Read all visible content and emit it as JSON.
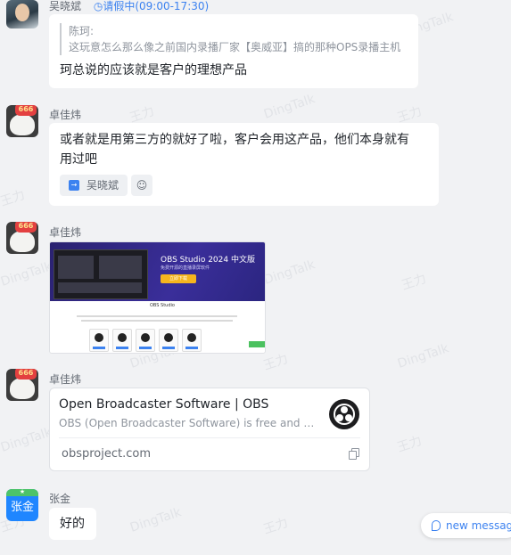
{
  "messages": [
    {
      "sender": "吴晓斌",
      "status": "请假中(09:00-17:30)",
      "quote_author": "陈珂:",
      "quote_text": "这玩意怎么那么像之前国内录播厂家【奥威亚】搞的那种OPS录播主机",
      "text": "珂总说的应该就是客户的理想产品"
    },
    {
      "sender": "卓佳炜",
      "text_line1": "或者就是用第三方的就好了啦，客户会用这产品，他们本身就有",
      "text_line2": "用过吧",
      "mention": "吴晓斌"
    },
    {
      "sender": "卓佳炜",
      "image": {
        "title": "OBS Studio 2024  中文版",
        "subtitle": "免费开源的直播录屏软件",
        "download_label": "立即下载",
        "logo_text": "OBS Studio"
      }
    },
    {
      "sender": "卓佳炜",
      "link_title": "Open Broadcaster Software | OBS",
      "link_desc": "OBS (Open Broadcaster Software) is free and op...",
      "link_url": "obsproject.com"
    },
    {
      "sender": "张金",
      "avatar_text": "张金",
      "text": "好的"
    }
  ],
  "new_message_label": "new messag",
  "avatar_badge": "666",
  "watermarks": [
    "王力",
    "DingTalk"
  ],
  "colors": {
    "accent": "#3c82f0",
    "background": "#f1f2f4",
    "bubble": "#ffffff"
  }
}
